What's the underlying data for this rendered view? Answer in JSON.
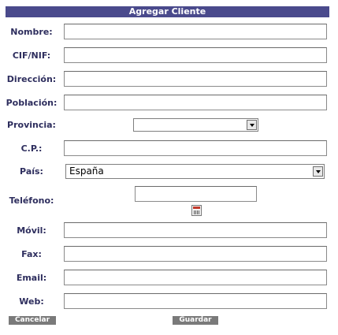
{
  "form": {
    "title": "Agregar Cliente",
    "labels": {
      "nombre": "Nombre:",
      "cif": "CIF/NIF:",
      "direccion": "Dirección:",
      "poblacion": "Población:",
      "provincia": "Provincia:",
      "cp": "C.P.:",
      "pais": "País:",
      "telefono": "Teléfono:",
      "movil": "Móvil:",
      "fax": "Fax:",
      "email": "Email:",
      "web": "Web:"
    },
    "values": {
      "nombre": "",
      "cif": "",
      "direccion": "",
      "poblacion": "",
      "provincia": "",
      "cp": "",
      "pais": "España",
      "telefono": "",
      "movil": "",
      "fax": "",
      "email": "",
      "web": ""
    },
    "buttons": {
      "cancel": "Cancelar",
      "save": "Guardar"
    },
    "icons": {
      "phone_book": "calendar-icon"
    },
    "colors": {
      "header_bg": "#4a4a8c",
      "label_text": "#2e2e5e",
      "button_bg": "#7a7a7a"
    }
  }
}
